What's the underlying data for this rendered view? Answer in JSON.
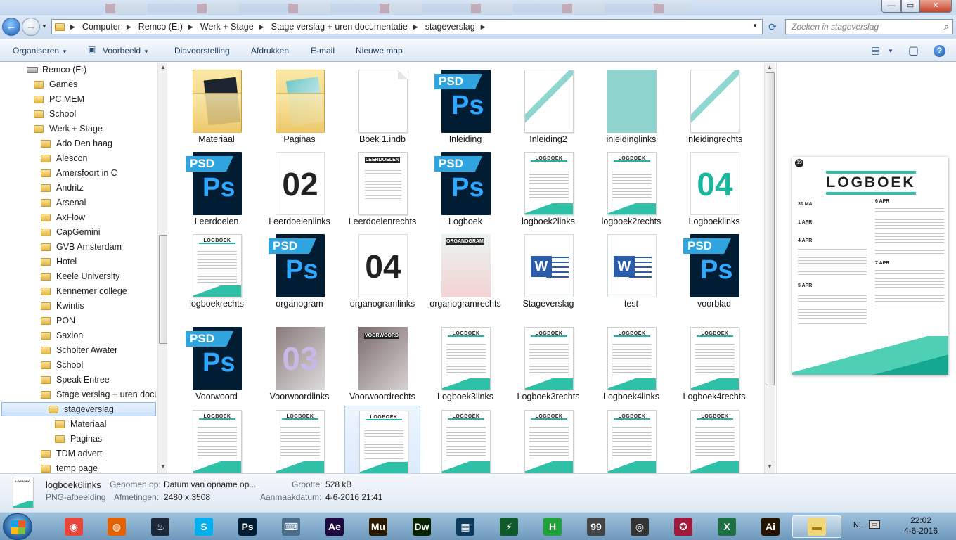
{
  "window": {
    "min": "—",
    "max": "▭",
    "close": "✕"
  },
  "address": {
    "crumbs": [
      "Computer",
      "Remco (E:)",
      "Werk + Stage",
      "Stage verslag + uren documentatie",
      "stageverslag"
    ],
    "search_placeholder": "Zoeken in stageverslag"
  },
  "toolbar": {
    "organize": "Organiseren",
    "preview": "Voorbeeld",
    "slideshow": "Diavoorstelling",
    "print": "Afdrukken",
    "email": "E-mail",
    "new_folder": "Nieuwe map"
  },
  "sidebar": {
    "drive": "Remco (E:)",
    "items": [
      "Games",
      "PC MEM",
      "School",
      "Werk + Stage",
      "Ado Den haag",
      "Alescon",
      "Amersfoort in C",
      "Andritz",
      "Arsenal",
      "AxFlow",
      "CapGemini",
      "GVB Amsterdam",
      "Hotel",
      "Keele University",
      "Kennemer college",
      "Kwintis",
      "PON",
      "Saxion",
      "Scholter Awater",
      "School",
      "Speak Entree",
      "Stage verslag + uren docur",
      "stageverslag",
      "Materiaal",
      "Paginas",
      "TDM advert",
      "temp page"
    ]
  },
  "files": [
    {
      "name": "Materiaal",
      "kind": "folder-dark"
    },
    {
      "name": "Paginas",
      "kind": "folder-teal"
    },
    {
      "name": "Boek 1.indb",
      "kind": "doc"
    },
    {
      "name": "Inleiding",
      "kind": "psd"
    },
    {
      "name": "Inleiding2",
      "kind": "diag"
    },
    {
      "name": "inleidinglinks",
      "kind": "teal"
    },
    {
      "name": "Inleidingrechts",
      "kind": "diag"
    },
    {
      "name": "Leerdoelen",
      "kind": "psd"
    },
    {
      "name": "Leerdoelenlinks",
      "kind": "num",
      "num": "02"
    },
    {
      "name": "Leerdoelenrechts",
      "kind": "leer",
      "title": "LEERDOELEN"
    },
    {
      "name": "Logboek",
      "kind": "psd"
    },
    {
      "name": "logboek2links",
      "kind": "logb"
    },
    {
      "name": "logboek2rechts",
      "kind": "logb"
    },
    {
      "name": "Logboeklinks",
      "kind": "num-teal",
      "num": "04"
    },
    {
      "name": "logboekrechts",
      "kind": "logb"
    },
    {
      "name": "organogram",
      "kind": "psd"
    },
    {
      "name": "organogramlinks",
      "kind": "num",
      "num": "04"
    },
    {
      "name": "organogramrechts",
      "kind": "org",
      "title": "ORGANOGRAM"
    },
    {
      "name": "Stageverslag",
      "kind": "word"
    },
    {
      "name": "test",
      "kind": "word"
    },
    {
      "name": "voorblad",
      "kind": "psd"
    },
    {
      "name": "Voorwoord",
      "kind": "psd"
    },
    {
      "name": "Voorwoordlinks",
      "kind": "num-voor",
      "num": "03"
    },
    {
      "name": "Voorwoordrechts",
      "kind": "voor",
      "title": "VOORWOORD"
    },
    {
      "name": "Logboek3links",
      "kind": "logb"
    },
    {
      "name": "Logboek3rechts",
      "kind": "logb"
    },
    {
      "name": "Logboek4links",
      "kind": "logb"
    },
    {
      "name": "Logboek4rechts",
      "kind": "logb"
    },
    {
      "name": "",
      "kind": "logb"
    },
    {
      "name": "",
      "kind": "logb"
    },
    {
      "name": "",
      "kind": "logb",
      "selected": true
    },
    {
      "name": "",
      "kind": "logb"
    },
    {
      "name": "",
      "kind": "logb"
    },
    {
      "name": "",
      "kind": "logb"
    },
    {
      "name": "",
      "kind": "logb"
    }
  ],
  "thumb_labels": {
    "ps": "Ps",
    "psd": "PSD",
    "logboek": "LOGBOEK",
    "word": "W"
  },
  "preview": {
    "page_num": "19",
    "title": "LOGBOEK",
    "dates": [
      "31 MA",
      "1 APR",
      "4 APR",
      "5 APR",
      "6 APR",
      "7 APR"
    ]
  },
  "details": {
    "name": "logboek6links",
    "type": "PNG-afbeelding",
    "taken_label": "Genomen op:",
    "taken_value": "Datum van opname op...",
    "size_label": "Grootte:",
    "size_value": "528 kB",
    "dims_label": "Afmetingen:",
    "dims_value": "2480 x 3508",
    "created_label": "Aanmaakdatum:",
    "created_value": "4-6-2016 21:41",
    "thumb_label": "LOGBOEK"
  },
  "taskbar": {
    "apps": [
      {
        "name": "chrome",
        "glyph": "◉",
        "bg": "#e8453c"
      },
      {
        "name": "firefox",
        "glyph": "◍",
        "bg": "#e66000"
      },
      {
        "name": "steam",
        "glyph": "♨",
        "bg": "#1b2838"
      },
      {
        "name": "skype",
        "glyph": "S",
        "bg": "#00aff0"
      },
      {
        "name": "photoshop",
        "glyph": "Ps",
        "bg": "#001d34"
      },
      {
        "name": "keyboard",
        "glyph": "⌨",
        "bg": "#4a6d8c"
      },
      {
        "name": "after-effects",
        "glyph": "Ae",
        "bg": "#1f0740"
      },
      {
        "name": "muse",
        "glyph": "Mu",
        "bg": "#2b1a00"
      },
      {
        "name": "dreamweaver",
        "glyph": "Dw",
        "bg": "#072401"
      },
      {
        "name": "media",
        "glyph": "▦",
        "bg": "#0b3a5c"
      },
      {
        "name": "app-green",
        "glyph": "⚡",
        "bg": "#0e5a2a"
      },
      {
        "name": "hotspot",
        "glyph": "H",
        "bg": "#22a33a"
      },
      {
        "name": "app-99",
        "glyph": "99",
        "bg": "#444444"
      },
      {
        "name": "app-circle",
        "glyph": "◎",
        "bg": "#333333"
      },
      {
        "name": "app-red",
        "glyph": "✪",
        "bg": "#a0183a"
      },
      {
        "name": "excel",
        "glyph": "X",
        "bg": "#1d7044"
      },
      {
        "name": "illustrator",
        "glyph": "Ai",
        "bg": "#261300"
      },
      {
        "name": "explorer",
        "glyph": "▬",
        "bg": "#f0d77a"
      }
    ],
    "lang": "NL",
    "time": "22:02",
    "date": "4-6-2016"
  },
  "colors": {
    "accent": "#2fc0a8",
    "psd_blue": "#31a8ff",
    "selection": "#cfe3fb"
  }
}
